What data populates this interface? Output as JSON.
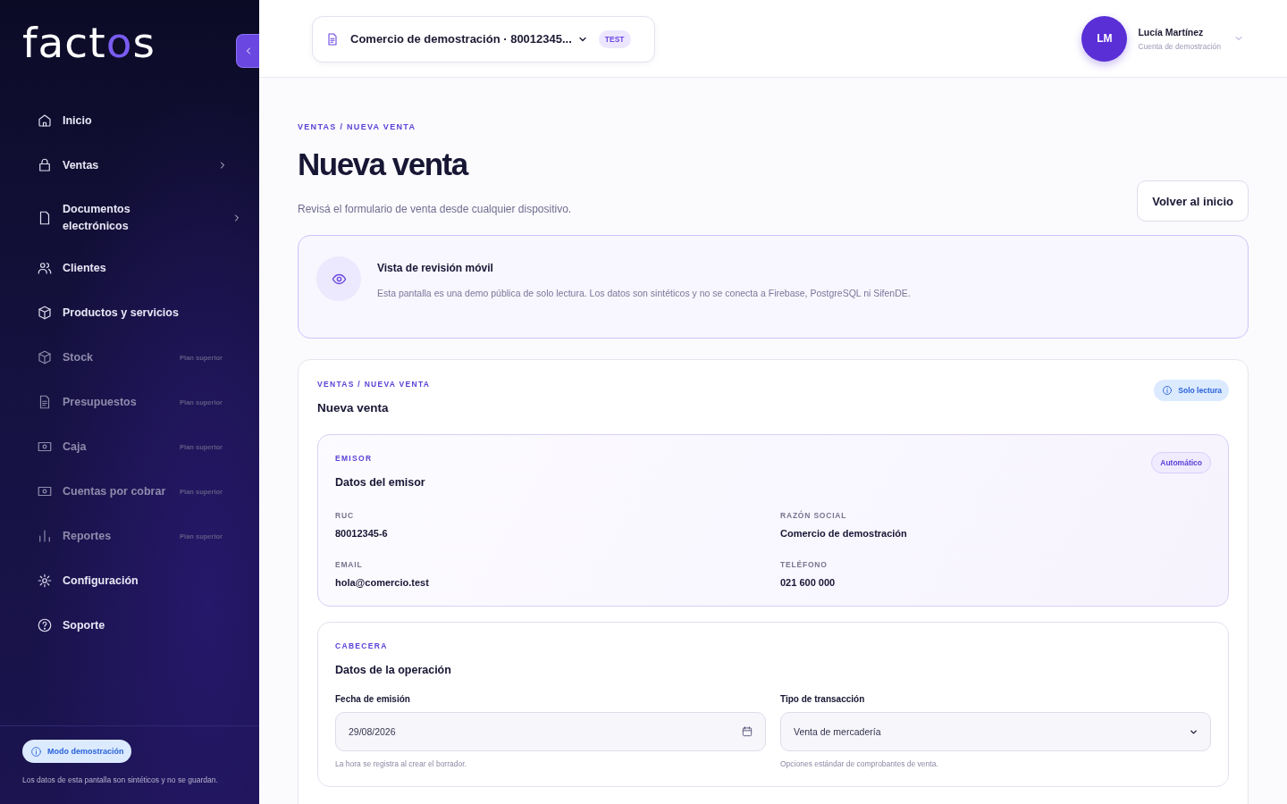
{
  "sidebar": {
    "logo": [
      {
        "text": "fact",
        "accent": false
      },
      {
        "text": "o",
        "accent": true
      },
      {
        "text": "s",
        "accent": false
      }
    ],
    "items": [
      {
        "kind": "home",
        "label": "Inicio",
        "expandable": false,
        "disabled": false
      },
      {
        "kind": "bag",
        "label": "Ventas",
        "expandable": true,
        "disabled": false
      },
      {
        "kind": "document",
        "label": "Documentos electrónicos",
        "expandable": true,
        "disabled": false
      },
      {
        "kind": "users",
        "label": "Clientes",
        "expandable": false,
        "disabled": false
      },
      {
        "kind": "box",
        "label": "Productos y servicios",
        "expandable": false,
        "disabled": false
      },
      {
        "kind": "box",
        "label": "Stock",
        "expandable": false,
        "disabled": true,
        "badge": "Plan superior"
      },
      {
        "kind": "document-lines",
        "label": "Presupuestos",
        "expandable": false,
        "disabled": true,
        "badge": "Plan superior"
      },
      {
        "kind": "cash",
        "label": "Caja",
        "expandable": false,
        "disabled": true,
        "badge": "Plan superior"
      },
      {
        "kind": "cash",
        "label": "Cuentas por cobrar",
        "expandable": false,
        "disabled": true,
        "badge": "Plan superior"
      },
      {
        "kind": "chart",
        "label": "Reportes",
        "expandable": false,
        "disabled": true,
        "badge": "Plan superior"
      },
      {
        "kind": "gear",
        "label": "Configuración",
        "expandable": false,
        "disabled": false
      },
      {
        "kind": "help",
        "label": "Soporte",
        "expandable": false,
        "disabled": false
      }
    ],
    "footer": {
      "badge": "Modo demostración",
      "note": "Los datos de esta pantalla son sintéticos y no se guardan."
    }
  },
  "header": {
    "company_selector": {
      "label": "Comercio de demostración · 80012345...",
      "tag": "TEST"
    },
    "user": {
      "initials": "LM",
      "name": "Lucía Martínez",
      "subtitle": "Cuenta de demostración"
    }
  },
  "page": {
    "breadcrumb": "VENTAS / NUEVA VENTA",
    "title": "Nueva venta",
    "subtitle": "Revisá el formulario de venta desde cualquier dispositivo.",
    "back_button": "Volver al inicio"
  },
  "notice": {
    "title": "Vista de revisión móvil",
    "text": "Esta pantalla es una demo pública de solo lectura. Los datos son sintéticos y no se conecta a Firebase, PostgreSQL ni SifenDE."
  },
  "form": {
    "breadcrumb": "VENTAS / NUEVA VENTA",
    "title": "Nueva venta",
    "status_badge": "Solo lectura",
    "sections": [
      {
        "kind": "fields",
        "eyebrow": "EMISOR",
        "title": "Datos del emisor",
        "badge": "Automático",
        "fields": [
          {
            "label": "RUC",
            "value": "80012345-6"
          },
          {
            "label": "RAZÓN SOCIAL",
            "value": "Comercio de demostración"
          },
          {
            "label": "EMAIL",
            "value": "hola@comercio.test"
          },
          {
            "label": "TELÉFONO",
            "value": "021 600 000"
          }
        ]
      },
      {
        "kind": "inputs",
        "eyebrow": "CABECERA",
        "title": "Datos de la operación",
        "inputs": [
          {
            "kind": "date",
            "label": "Fecha de emisión",
            "value": "29/08/2026",
            "hint": "La hora se registra al crear el borrador."
          },
          {
            "kind": "select",
            "label": "Tipo de transacción",
            "value": "Venta de mercadería",
            "hint": "Opciones estándar de comprobantes de venta."
          }
        ]
      }
    ]
  }
}
